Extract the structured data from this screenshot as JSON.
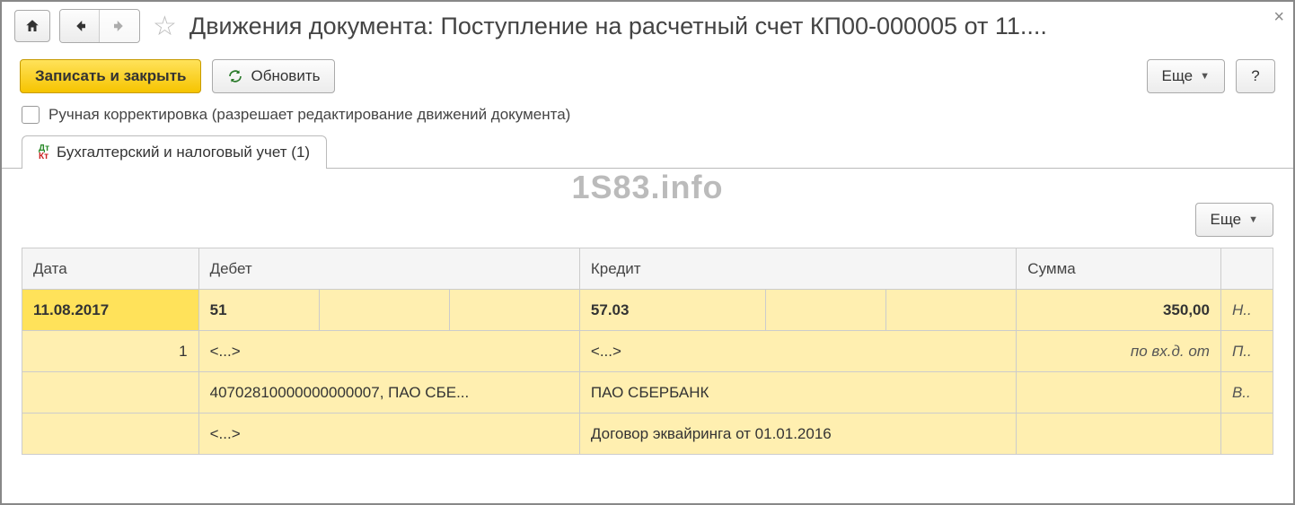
{
  "title": "Движения документа: Поступление на расчетный счет КП00-000005 от 11....",
  "toolbar": {
    "save_close": "Записать и закрыть",
    "refresh": "Обновить",
    "more": "Еще",
    "help": "?"
  },
  "manual_edit_label": "Ручная корректировка (разрешает редактирование движений документа)",
  "tab_label": "Бухгалтерский и налоговый учет (1)",
  "watermark": "1S83.info",
  "sub_more": "Еще",
  "table": {
    "headers": {
      "date": "Дата",
      "debit": "Дебет",
      "credit": "Кредит",
      "sum": "Сумма"
    },
    "row1": {
      "date": "11.08.2017",
      "debit_account": "51",
      "credit_account": "57.03",
      "sum": "350,00",
      "note": "Н.."
    },
    "row2": {
      "seq": "1",
      "debit_sub1": "<...>",
      "credit_sub1": "<...>",
      "sum_note": "по вх.д.  от",
      "note": "П.."
    },
    "row3": {
      "debit_sub2": "40702810000000000007, ПАО СБЕ...",
      "credit_sub2": "ПАО СБЕРБАНК",
      "note": "В.."
    },
    "row4": {
      "debit_sub3": "<...>",
      "credit_sub3": "Договор эквайринга от 01.01.2016"
    }
  }
}
